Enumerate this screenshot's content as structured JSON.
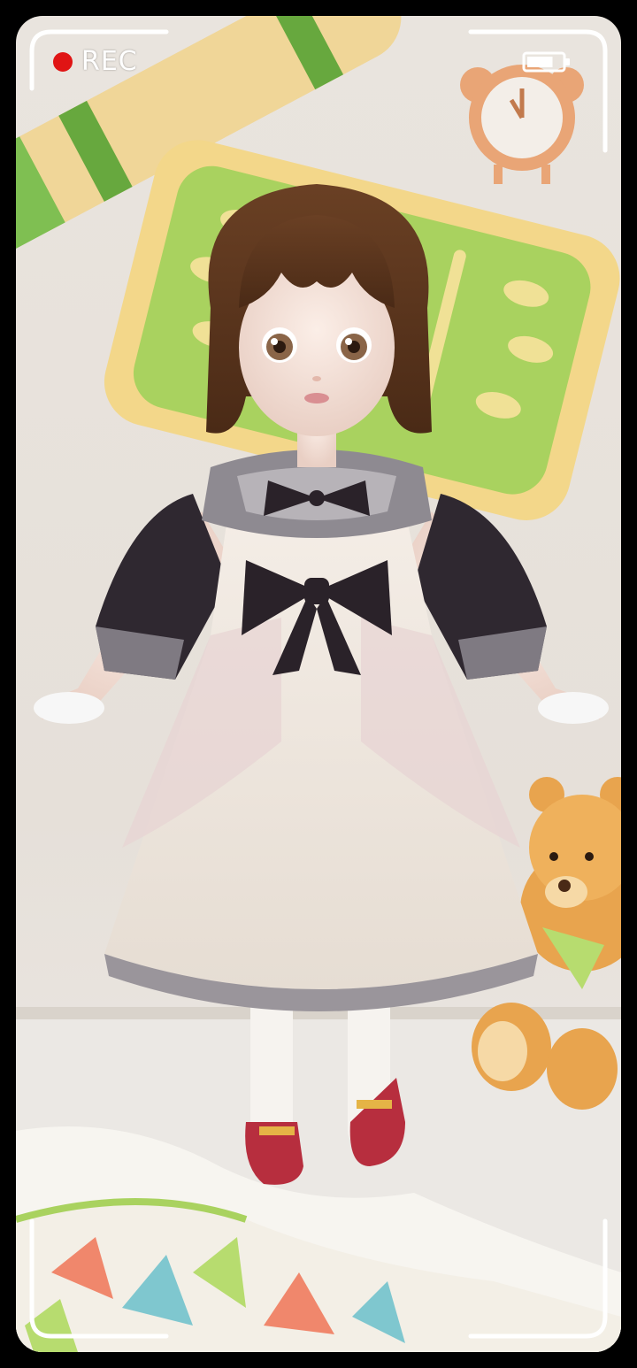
{
  "hud": {
    "rec_label": "REC",
    "rec_color": "#e01414",
    "battery_level": 0.75
  },
  "scene": {
    "character": "doll-girl-in-white-dress",
    "props": [
      "rolled-mat",
      "green-pillow",
      "alarm-clock",
      "teddy-bear",
      "patterned-blanket"
    ]
  }
}
